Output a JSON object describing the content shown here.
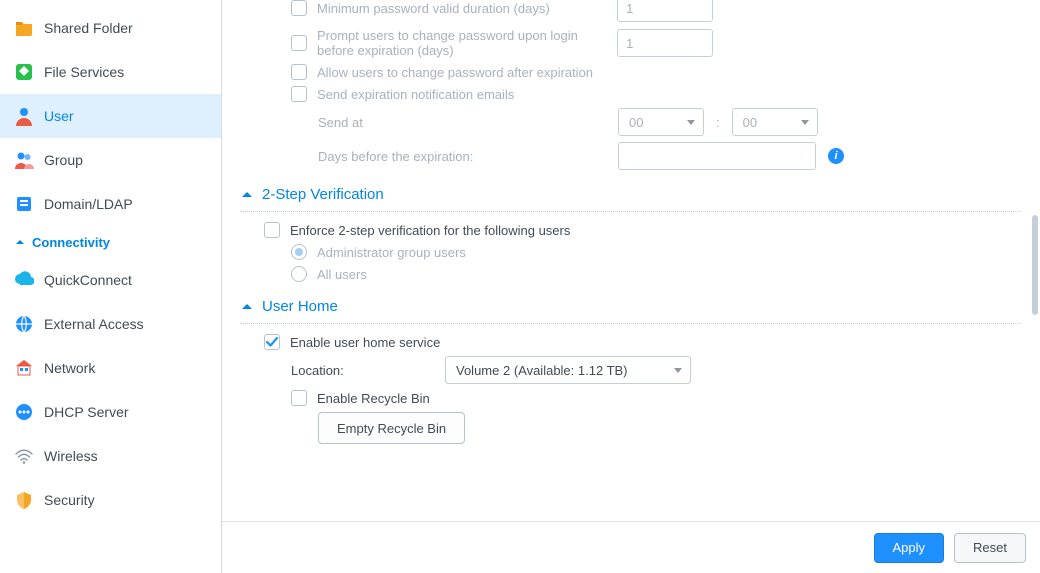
{
  "sidebar": {
    "items": [
      {
        "label": "Shared Folder",
        "icon": "shared-folder"
      },
      {
        "label": "File Services",
        "icon": "file-services"
      },
      {
        "label": "User",
        "icon": "user",
        "selected": true
      },
      {
        "label": "Group",
        "icon": "group"
      },
      {
        "label": "Domain/LDAP",
        "icon": "domain-ldap"
      }
    ],
    "section_header": "Connectivity",
    "items2": [
      {
        "label": "QuickConnect",
        "icon": "quickconnect"
      },
      {
        "label": "External Access",
        "icon": "external-access"
      },
      {
        "label": "Network",
        "icon": "network"
      },
      {
        "label": "DHCP Server",
        "icon": "dhcp"
      },
      {
        "label": "Wireless",
        "icon": "wireless"
      },
      {
        "label": "Security",
        "icon": "security"
      }
    ]
  },
  "password_section": {
    "min_valid_label": "Minimum password valid duration (days)",
    "min_valid_value": "1",
    "prompt_label": "Prompt users to change password upon login before expiration (days)",
    "prompt_value": "1",
    "allow_after_label": "Allow users to change password after expiration",
    "send_emails_label": "Send expiration notification emails",
    "send_at_label": "Send at",
    "hour": "00",
    "minute": "00",
    "days_before_label": "Days before the expiration:"
  },
  "two_step": {
    "title": "2-Step Verification",
    "enforce_label": "Enforce 2-step verification for the following users",
    "opt_admin": "Administrator group users",
    "opt_all": "All users"
  },
  "user_home": {
    "title": "User Home",
    "enable_label": "Enable user home service",
    "location_label": "Location:",
    "location_value": "Volume 2 (Available: 1.12 TB)",
    "recycle_label": "Enable Recycle Bin",
    "empty_btn": "Empty Recycle Bin"
  },
  "footer": {
    "apply": "Apply",
    "reset": "Reset"
  }
}
